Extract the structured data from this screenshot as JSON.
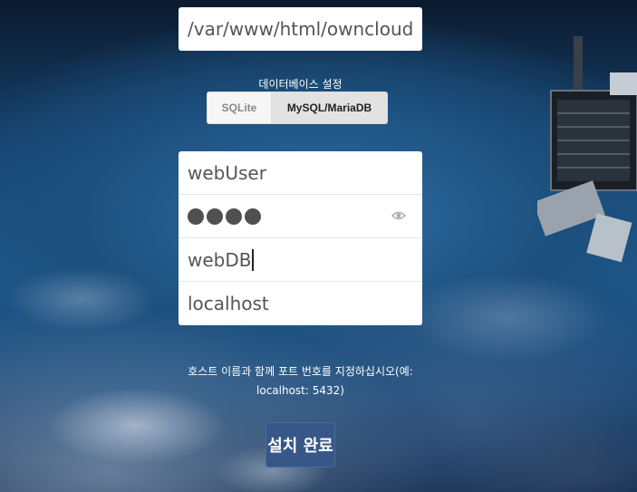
{
  "data_directory": {
    "value": "/var/www/html/owncloud/d"
  },
  "database": {
    "legend": "데이터베이스 설정",
    "tabs": [
      {
        "label": "SQLite",
        "selected": false
      },
      {
        "label": "MySQL/MariaDB",
        "selected": true
      }
    ],
    "user": "webUser",
    "password_dot_count": 4,
    "name": "webDB",
    "host": "localhost"
  },
  "hint": {
    "line1": "호스트 이름과 함께 포트 번호를 지정하십시오(예:",
    "line2": "localhost: 5432)"
  },
  "finish_button_label": "설치 완료",
  "colors": {
    "accent": "#385789",
    "field_text": "#555555",
    "password_dot": "#505050"
  },
  "icons": {
    "password_toggle": "eye-icon"
  }
}
